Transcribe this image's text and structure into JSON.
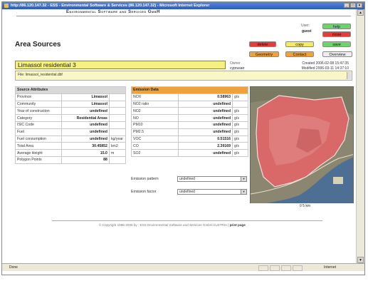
{
  "window": {
    "title": "http://86.120.147.32 - ESS - Environmental Software & Services (86.120.147.32) - Microsoft Internet Explorer",
    "minimize": "_",
    "maximize": "□",
    "close": "×"
  },
  "brand": "Environmental Software and Services GmbH",
  "page_title": "Area Sources",
  "user": {
    "label": "User:",
    "name": "guest"
  },
  "buttons": {
    "help": "help",
    "close": "close",
    "delete": "delete",
    "copy": "copy",
    "save": "save",
    "geometry": "Geometry",
    "contact": "Contact",
    "overview": "Overview"
  },
  "source_name": "Limassol residential 3",
  "owner": {
    "label": "Owner",
    "value": "cyprusair"
  },
  "created": "Created 2006-02-08 15:47:35",
  "modified": "Modified 2006-03-11 14:37:10",
  "file": "File: limassol_residential.dbf",
  "source_attributes": {
    "header": "Source Attributes",
    "rows": [
      {
        "label": "Province",
        "value": "Limassol",
        "unit": ""
      },
      {
        "label": "Community",
        "value": "Limassol",
        "unit": ""
      },
      {
        "label": "Year of construction",
        "value": "undefined",
        "unit": ""
      },
      {
        "label": "Category",
        "value": "Residential Areas",
        "unit": ""
      },
      {
        "label": "ISIC Code",
        "value": "undefined",
        "unit": ""
      },
      {
        "label": "Fuel",
        "value": "undefined",
        "unit": ""
      },
      {
        "label": "Fuel consumption",
        "value": "undefined",
        "unit": "kg/year"
      },
      {
        "label": "Total Area",
        "value": "30.45852",
        "unit": "km2"
      },
      {
        "label": "Average Height",
        "value": "15.0",
        "unit": "m"
      },
      {
        "label": "Polygon Points",
        "value": "88",
        "unit": ""
      }
    ]
  },
  "emission_data": {
    "header": "Emission Data",
    "rows": [
      {
        "label": "NOX",
        "value": "0.58963",
        "unit": "g/s"
      },
      {
        "label": "NO2 ratio",
        "value": "undefined",
        "unit": ""
      },
      {
        "label": "NO2",
        "value": "undefined",
        "unit": "g/s"
      },
      {
        "label": "NO",
        "value": "undefined",
        "unit": "g/s"
      },
      {
        "label": "PM10",
        "value": "undefined",
        "unit": "g/s"
      },
      {
        "label": "PM2.5",
        "value": "undefined",
        "unit": "g/s"
      },
      {
        "label": "VOC",
        "value": "0.51516",
        "unit": "g/s"
      },
      {
        "label": "CO",
        "value": "2.39169",
        "unit": "g/s"
      },
      {
        "label": "SO2",
        "value": "undefined",
        "unit": "g/s"
      }
    ],
    "pattern_label": "Emission pattern",
    "pattern_value": "undefined",
    "factor_label": "Emission factor",
    "factor_value": "undefined"
  },
  "map": {
    "scale": "0   5 km"
  },
  "footer": {
    "copyright": "© Copyright 1995-2006 by : ESS Environmental Software and Services GmbH AUSTRIA |",
    "print": "print page"
  },
  "status": {
    "left": "Done",
    "zone": "Internet"
  }
}
